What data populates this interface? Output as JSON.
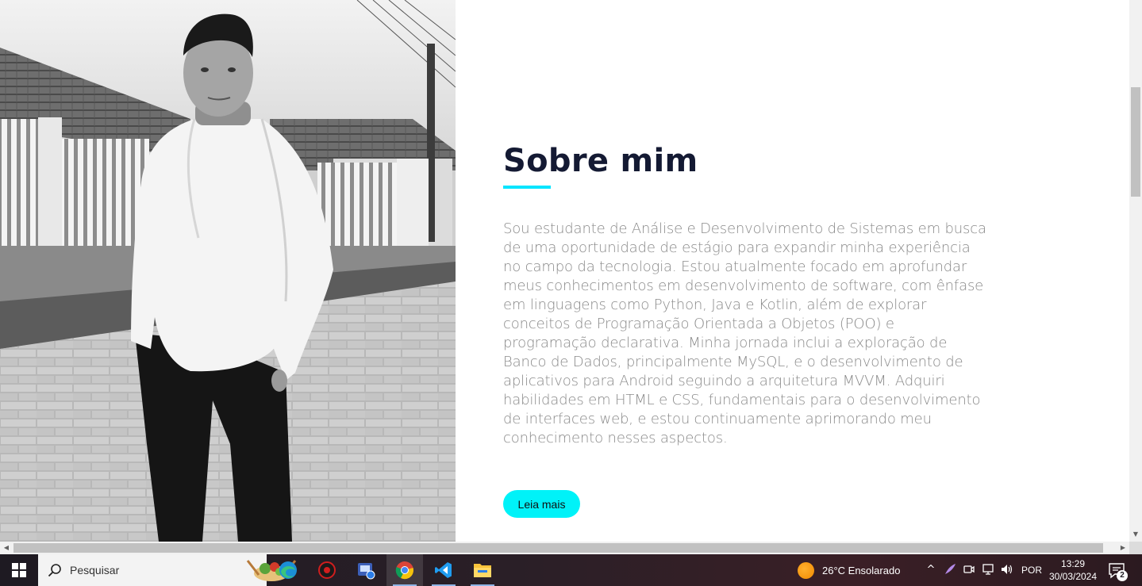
{
  "about": {
    "title": "Sobre mim",
    "paragraph": "Sou estudante de Análise e Desenvolvimento de Sistemas em busca de uma oportunidade de estágio para expandir minha experiência no campo da tecnologia. Estou atualmente focado em aprofundar meus conhecimentos em desenvolvimento de software, com ênfase em linguagens como Python, Java e Kotlin, além de explorar conceitos de Programação Orientada a Objetos (POO) e programação declarativa. Minha jornada inclui a exploração de Banco de Dados, principalmente MySQL, e o desenvolvimento de aplicativos para Android seguindo a arquitetura MVVM. Adquiri habilidades em HTML e CSS, fundamentais para o desenvolvimento de interfaces web, e estou continuamente aprimorando meu conhecimento nesses aspectos.",
    "button_label": "Leia mais",
    "accent_color": "#00e5ff",
    "title_color": "#141a33"
  },
  "taskbar": {
    "search_placeholder": "Pesquisar",
    "apps": [
      "edge-icon",
      "security-app-icon",
      "remote-desktop-icon",
      "chrome-icon",
      "vscode-icon",
      "file-explorer-icon"
    ],
    "weather": "26°C  Ensolarado",
    "language": "POR",
    "time": "13:29",
    "date": "30/03/2024",
    "notification_count": "2"
  }
}
